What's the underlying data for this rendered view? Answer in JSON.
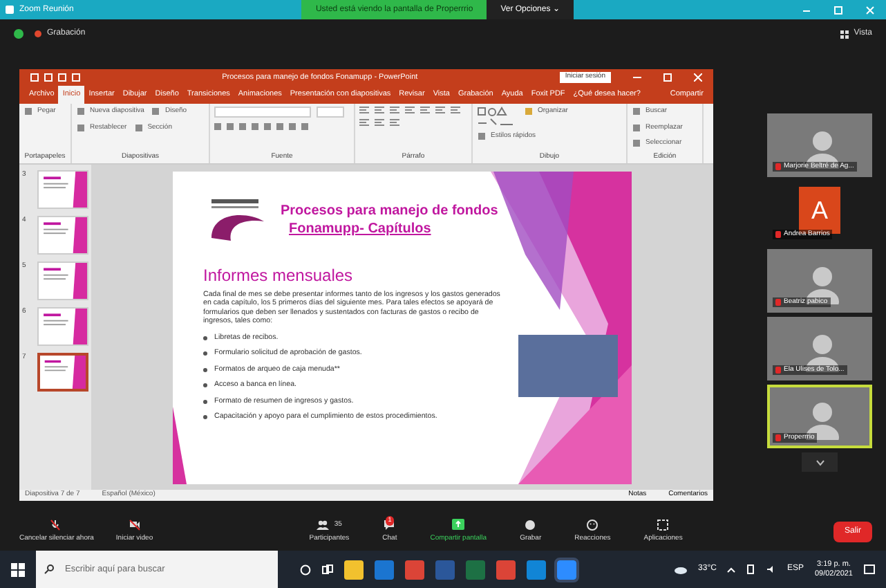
{
  "zoom_title_bar": {
    "title": "Zoom Reunión",
    "sharing_banner": "Usted está viendo la pantalla de Properrrio",
    "view_options_button": "Ver Opciones ⌄"
  },
  "meeting_header": {
    "recording_label": "Grabación",
    "view_button": "Vista"
  },
  "powerpoint": {
    "title": "Procesos para manejo de fondos Fonamupp - PowerPoint",
    "sign_in_button": "Iniciar sesión",
    "tabs": [
      {
        "label": "Archivo",
        "selected": false
      },
      {
        "label": "Inicio",
        "selected": true
      },
      {
        "label": "Insertar",
        "selected": false
      },
      {
        "label": "Dibujar",
        "selected": false
      },
      {
        "label": "Diseño",
        "selected": false
      },
      {
        "label": "Transiciones",
        "selected": false
      },
      {
        "label": "Animaciones",
        "selected": false
      },
      {
        "label": "Presentación con diapositivas",
        "selected": false
      },
      {
        "label": "Revisar",
        "selected": false
      },
      {
        "label": "Vista",
        "selected": false
      },
      {
        "label": "Grabación",
        "selected": false
      },
      {
        "label": "Ayuda",
        "selected": false
      },
      {
        "label": "Foxit PDF",
        "selected": false
      },
      {
        "label": "¿Qué desea hacer?",
        "selected": false
      }
    ],
    "share_button": "Compartir",
    "ribbon_groups": [
      {
        "label": "Portapapeles",
        "buttons": [
          "Pegar"
        ]
      },
      {
        "label": "Diapositivas",
        "buttons": [
          "Nueva diapositiva",
          "Diseño",
          "Restablecer",
          "Sección"
        ]
      },
      {
        "label": "Fuente"
      },
      {
        "label": "Párrafo"
      },
      {
        "label": "Dibujo",
        "buttons": [
          "Organizar",
          "Estilos rápidos"
        ]
      },
      {
        "label": "Edición",
        "buttons": [
          "Buscar",
          "Reemplazar",
          "Seleccionar"
        ]
      }
    ],
    "thumbnails": [
      {
        "number": "3",
        "selected": false
      },
      {
        "number": "4",
        "selected": false
      },
      {
        "number": "5",
        "selected": false
      },
      {
        "number": "6",
        "selected": false
      },
      {
        "number": "7",
        "selected": true
      }
    ],
    "slide": {
      "title_lines": [
        "Procesos para manejo de fondos",
        "Fonamupp- Capítulos"
      ],
      "heading": "Informes mensuales",
      "paragraph": "Cada final de mes se debe presentar informes tanto de los ingresos y los gastos generados en cada capítulo, los 5 primeros días del siguiente mes. Para tales efectos se apoyará de formularios que deben ser llenados y sustentados con facturas de gastos o recibo de ingresos, tales como:",
      "bullets": [
        "Libretas de recibos.",
        "Formulario solicitud de aprobación de gastos.",
        "Formatos de arqueo de caja menuda**",
        "Acceso a banca en línea.",
        "Formato de resumen de ingresos y gastos.",
        "Capacitación y apoyo para el cumplimiento de estos procedimientos."
      ]
    },
    "status_bar": {
      "slide_count": "Diapositiva 7 de 7",
      "language": "Español (México)",
      "notes": "Notas",
      "comments": "Comentarios"
    }
  },
  "participants": [
    {
      "name": "Marjorie Beltré de Ag...",
      "kind": "video",
      "speaking": false
    },
    {
      "name": "Andrea Barrios",
      "kind": "avatar",
      "initial": "A",
      "speaking": false
    },
    {
      "name": "Beatriz pabico",
      "kind": "video",
      "speaking": false
    },
    {
      "name": "Ela Ulises de Tolo...",
      "kind": "video",
      "speaking": false
    },
    {
      "name": "Properrrio",
      "kind": "video",
      "speaking": true
    }
  ],
  "meeting_toolbar": [
    {
      "label": "Cancelar silenciar ahora",
      "kind": "mic"
    },
    {
      "label": "Iniciar video",
      "kind": "video"
    },
    {
      "label": "Participantes",
      "kind": "participants",
      "count": "35"
    },
    {
      "label": "Chat",
      "kind": "chat",
      "badge": "1"
    },
    {
      "label": "Compartir pantalla",
      "kind": "share"
    },
    {
      "label": "Grabar",
      "kind": "record"
    },
    {
      "label": "Reacciones",
      "kind": "reactions"
    },
    {
      "label": "Aplicaciones",
      "kind": "apps"
    }
  ],
  "leave_button": "Salir",
  "taskbar": {
    "search_placeholder": "Escribir aquí para buscar",
    "apps": [
      {
        "kind": "folder",
        "color": "#f2c12e"
      },
      {
        "kind": "mail",
        "color": "#1b75d0"
      },
      {
        "kind": "chrome",
        "color": "#db4437"
      },
      {
        "kind": "doc",
        "color": "#2b579a"
      },
      {
        "kind": "excel",
        "color": "#1d7044"
      },
      {
        "kind": "chrome",
        "color": "#db4437"
      },
      {
        "kind": "edge",
        "color": "#1185d6"
      },
      {
        "kind": "zoom",
        "color": "#2d8cff"
      }
    ],
    "temperature": "33°C",
    "language": "ESP",
    "time": "3:19 p. m.",
    "date": "09/02/2021"
  }
}
